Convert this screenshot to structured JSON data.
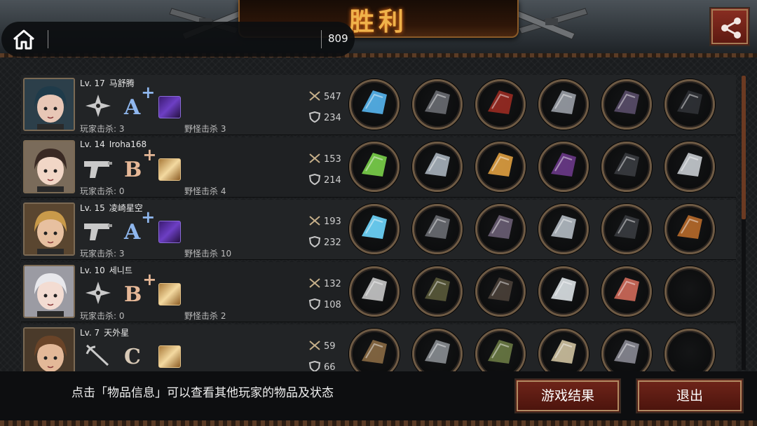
{
  "header": {
    "title": "胜利",
    "home_icon": "home-icon",
    "count": "809",
    "share_icon": "share-icon"
  },
  "players": [
    {
      "level_text": "Lv. 17",
      "name": "马舒腾",
      "weapon_icon": "shuriken-icon",
      "grade": "A",
      "grade_plus": "+",
      "grade_color": "#8fb7ee",
      "cube_icon": "purple-cube-icon",
      "cube_style": "purple",
      "player_kills": "玩家击杀: 3",
      "monster_kills": "野怪击杀 3",
      "attack": "547",
      "defense": "234",
      "items": [
        "blue-energy-blade-icon",
        "steel-helmet-icon",
        "red-plate-armor-icon",
        "spiked-gauntlet-icon",
        "dark-armored-gloves-icon",
        "black-banner-spear-icon"
      ]
    },
    {
      "level_text": "Lv. 14",
      "name": "Iroha168",
      "weapon_icon": "pistol-icon",
      "grade": "B",
      "grade_plus": "+",
      "grade_color": "#e6b897",
      "cube_icon": "gold-cube-icon",
      "cube_style": "gold",
      "player_kills": "玩家击杀: 0",
      "monster_kills": "野怪击杀 4",
      "attack": "153",
      "defense": "214",
      "items": [
        "energy-rifle-icon",
        "knight-helmet-icon",
        "golden-scale-armor-icon",
        "purple-gauntlet-icon",
        "spiked-boots-icon",
        "pearl-orb-icon"
      ]
    },
    {
      "level_text": "Lv. 15",
      "name": "凌崎星空",
      "weapon_icon": "pistol-icon",
      "grade": "A",
      "grade_plus": "+",
      "grade_color": "#8fb7ee",
      "cube_icon": "purple-cube-icon",
      "cube_style": "purple",
      "player_kills": "玩家击杀: 3",
      "monster_kills": "野怪击杀 10",
      "attack": "193",
      "defense": "232",
      "items": [
        "laser-sword-icon",
        "steel-helmet-icon",
        "heavy-armor-icon",
        "spiked-bracer-icon",
        "spiked-boots-icon",
        "wooden-cross-icon"
      ]
    },
    {
      "level_text": "Lv. 10",
      "name": "세니트",
      "weapon_icon": "shuriken-icon",
      "grade": "B",
      "grade_plus": "+",
      "grade_color": "#e6b897",
      "cube_icon": "gold-cube-icon",
      "cube_style": "gold",
      "player_kills": "玩家击杀: 0",
      "monster_kills": "野怪击杀 2",
      "attack": "132",
      "defense": "108",
      "items": [
        "blade-wheel-icon",
        "army-helmet-icon",
        "leather-jacket-icon",
        "white-gloves-icon",
        "sneakers-icon",
        "empty-slot"
      ]
    },
    {
      "level_text": "Lv. 7",
      "name": "天外星",
      "weapon_icon": "rapier-icon",
      "grade": "C",
      "grade_plus": "",
      "grade_color": "#d8c9b6",
      "cube_icon": "gold-cube-icon",
      "cube_style": "gold",
      "player_kills": "",
      "monster_kills": "",
      "attack": "59",
      "defense": "66",
      "items": [
        "spear-icon",
        "headband-icon",
        "camo-vest-icon",
        "bracer-icon",
        "chain-whip-icon",
        "empty-slot"
      ]
    }
  ],
  "footer": {
    "hint": "点击「物品信息」可以查看其他玩家的物品及状态",
    "result_button": "游戏结果",
    "exit_button": "退出"
  }
}
